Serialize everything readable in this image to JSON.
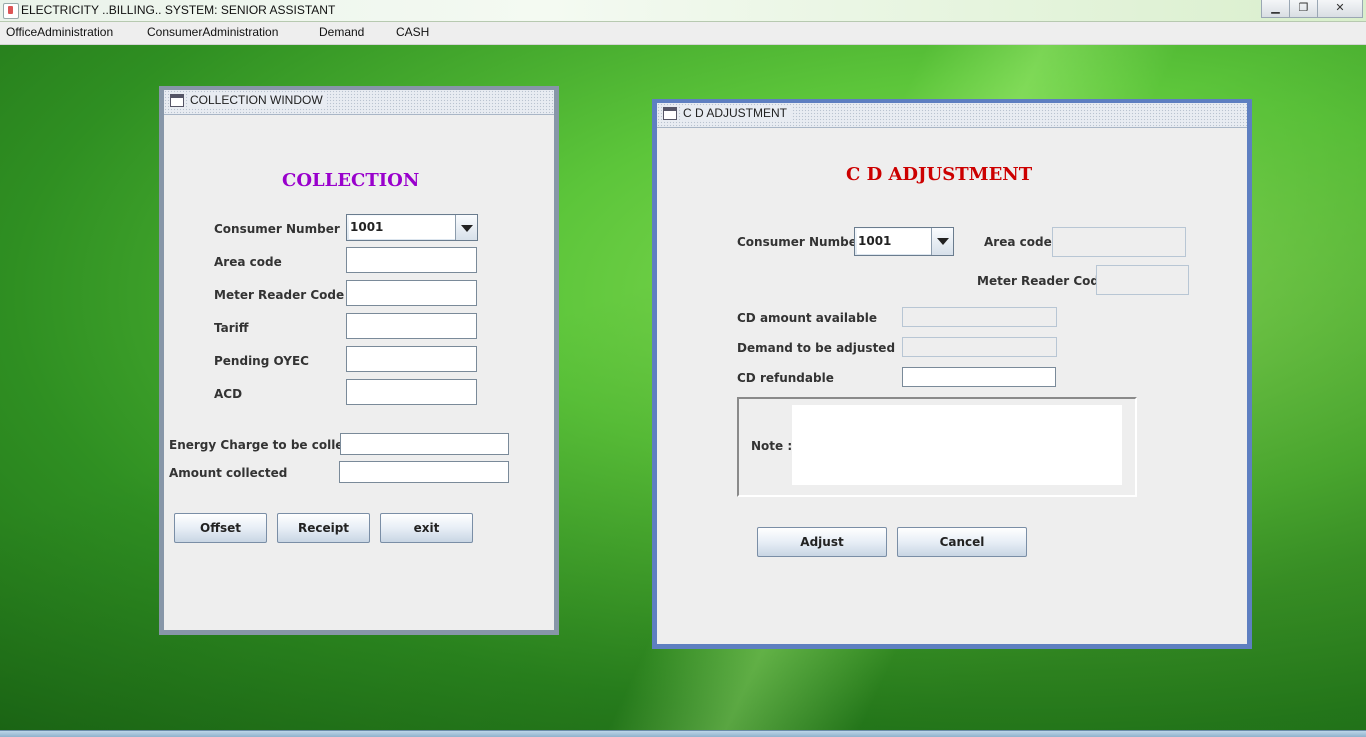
{
  "app": {
    "title": "ELECTRICITY ..BILLING.. SYSTEM: SENIOR ASSISTANT",
    "controls": [
      "minimize",
      "maximize",
      "close"
    ]
  },
  "menu": {
    "items": [
      "OfficeAdministration",
      "ConsumerAdministration",
      "Demand",
      "CASH"
    ]
  },
  "collection": {
    "frame_title": "COLLECTION WINDOW",
    "heading": "COLLECTION",
    "heading_color": "#9900cc",
    "consumer_number_label": "Consumer Number",
    "consumer_number_value": "1001",
    "area_code_label": "Area code",
    "meter_reader_code_label": "Meter Reader Code",
    "tariff_label": "Tariff",
    "pending_oyec_label": "Pending OYEC",
    "acd_label": "ACD",
    "energy_charge_label": "Energy Charge to be collected",
    "amount_collected_label": "Amount  collected",
    "buttons": {
      "offset": "Offset",
      "receipt": "Receipt",
      "exit": "exit"
    }
  },
  "cd_adjustment": {
    "frame_title": "C D ADJUSTMENT",
    "heading": "C D ADJUSTMENT",
    "heading_color": "#cc0000",
    "consumer_number_label": "Consumer Number",
    "consumer_number_value": "1001",
    "area_code_label": "Area code",
    "meter_reader_code_label": "Meter Reader Code",
    "cd_amount_label": "CD amount available",
    "demand_label": "Demand to be adjusted",
    "cd_refundable_label": "CD refundable",
    "note_label": "Note  :",
    "buttons": {
      "adjust": "Adjust",
      "cancel": "Cancel"
    }
  }
}
